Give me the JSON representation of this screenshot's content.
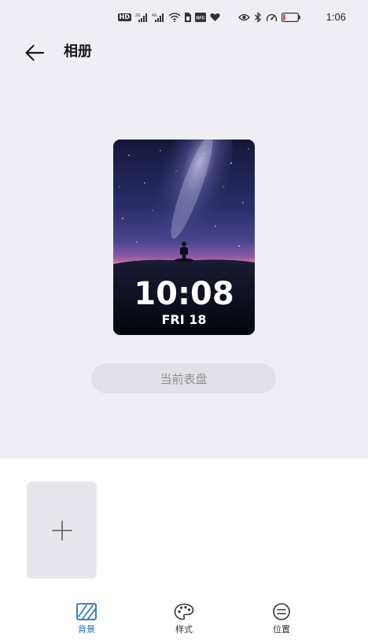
{
  "status_bar": {
    "time": "1:06",
    "network_labels": [
      "HD",
      "2G",
      "4G"
    ],
    "nfc_label": "NFC"
  },
  "header": {
    "title": "相册",
    "back_icon": "arrow-left-icon"
  },
  "watch_preview": {
    "time": "10:08",
    "date": "FRI 18"
  },
  "current_face_button": {
    "label": "当前表盘"
  },
  "add_photo": {
    "icon": "plus-icon"
  },
  "tabs": [
    {
      "label": "背景",
      "icon": "background-icon",
      "active": true
    },
    {
      "label": "样式",
      "icon": "palette-icon",
      "active": false
    },
    {
      "label": "位置",
      "icon": "position-icon",
      "active": false
    }
  ],
  "colors": {
    "page_background": "#efeef5",
    "panel_background": "#ffffff",
    "accent": "#1e73c4",
    "button_background": "#e2e1e7",
    "button_text": "#8d8d92"
  }
}
